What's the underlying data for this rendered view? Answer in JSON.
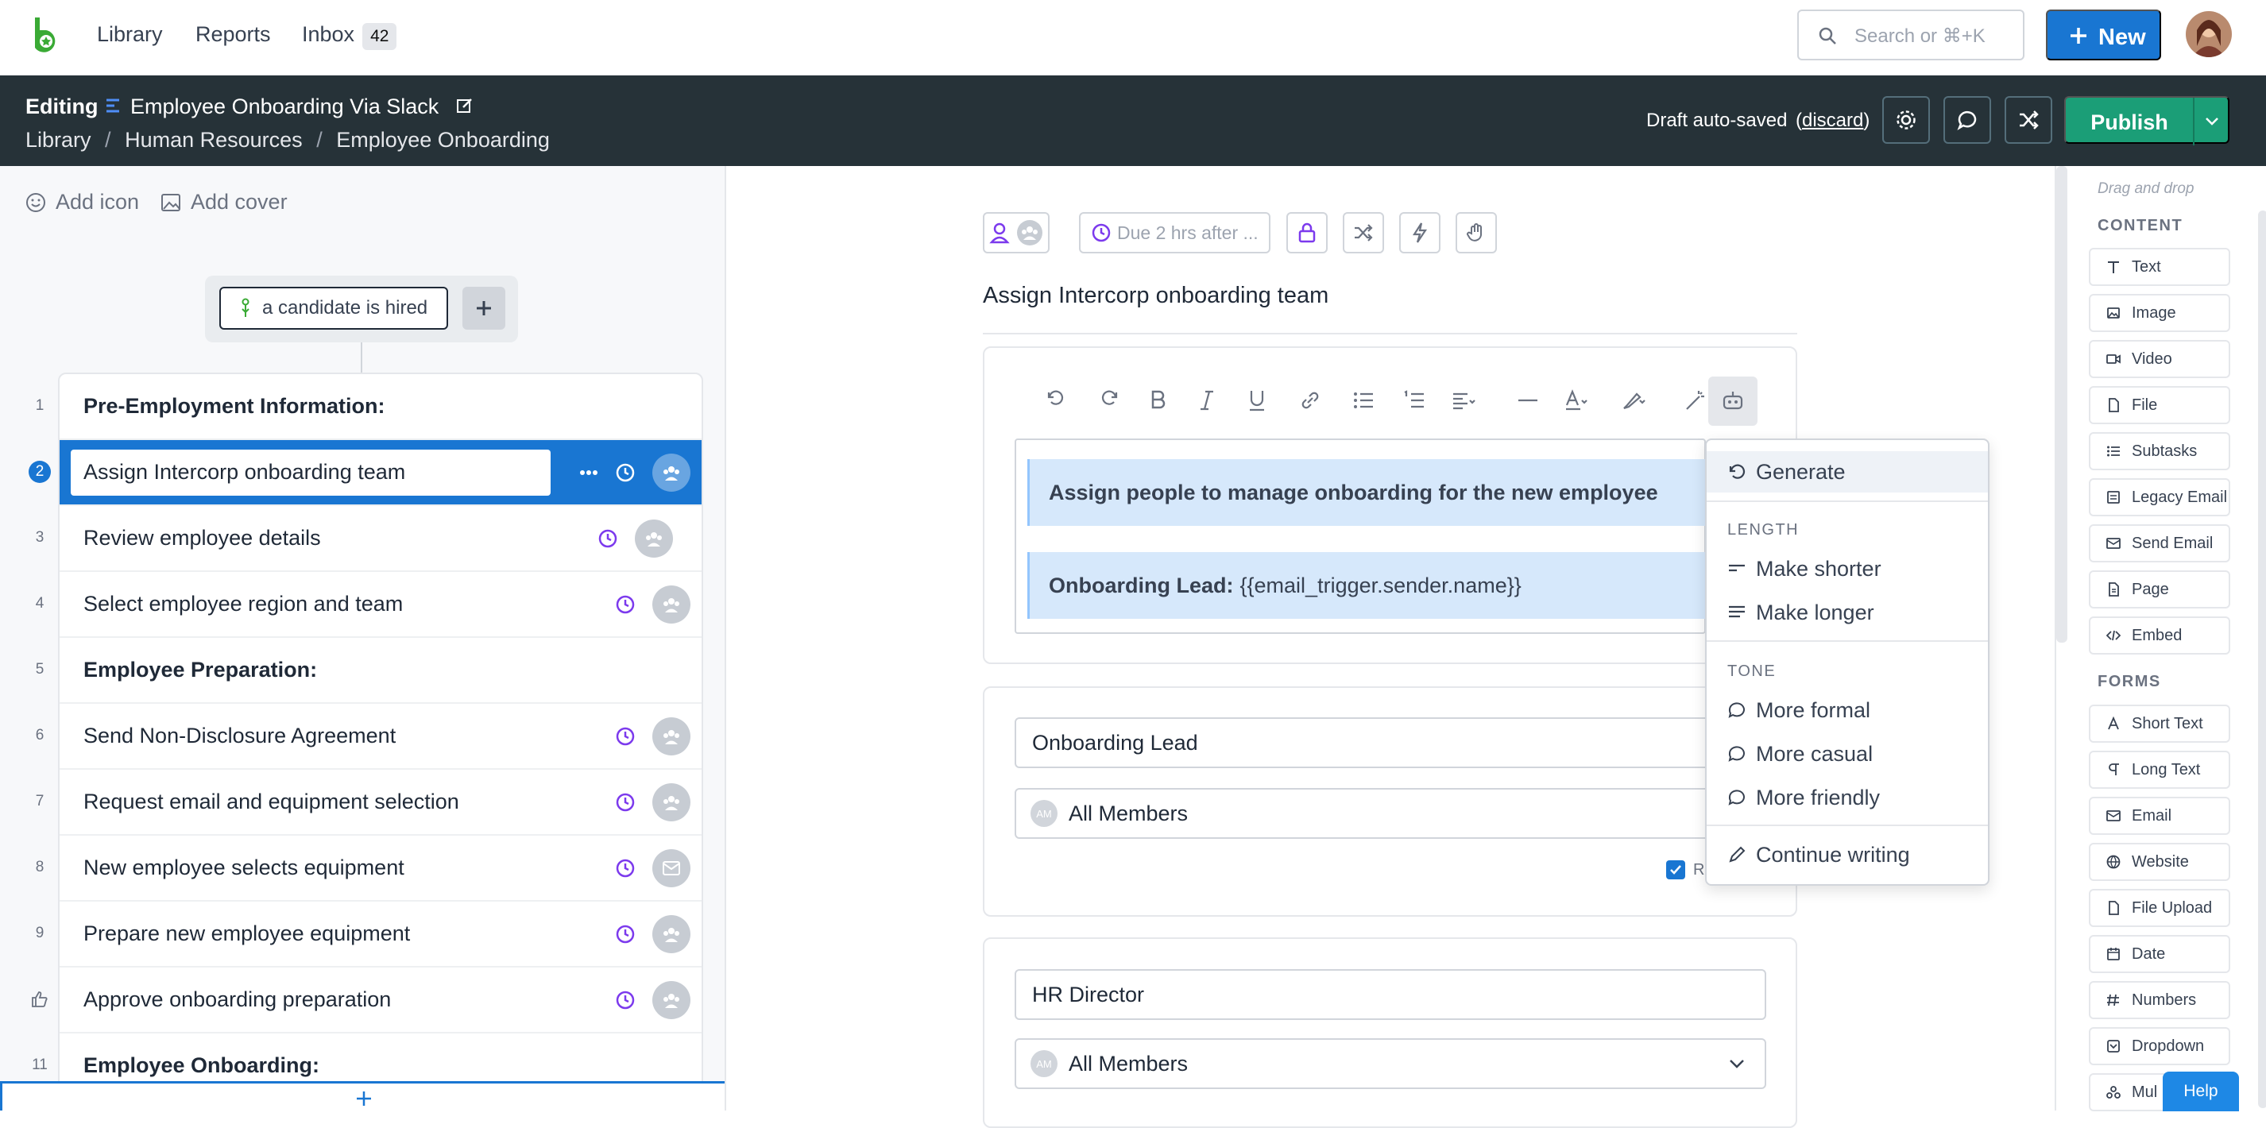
{
  "nav": {
    "links": [
      "Library",
      "Reports",
      "Inbox"
    ],
    "inbox_count": "42",
    "search_placeholder": "Search or ⌘+K",
    "new_label": "New"
  },
  "editbar": {
    "mode": "Editing",
    "workflow_title": "Employee Onboarding Via Slack",
    "breadcrumb": [
      "Library",
      "Human Resources",
      "Employee Onboarding"
    ],
    "autosave_text": "Draft auto-saved",
    "discard_label": "discard",
    "publish_label": "Publish"
  },
  "left": {
    "add_icon": "Add icon",
    "add_cover": "Add cover",
    "trigger_label": "a candidate is hired",
    "steps": [
      {
        "num": "1",
        "label": "Pre-Employment Information:",
        "heading": true
      },
      {
        "num": "2",
        "label": "Assign Intercorp onboarding team",
        "selected": true
      },
      {
        "num": "3",
        "label": "Review employee details"
      },
      {
        "num": "4",
        "label": "Select employee region and team"
      },
      {
        "num": "5",
        "label": "Employee Preparation:",
        "heading": true
      },
      {
        "num": "6",
        "label": "Send Non-Disclosure Agreement"
      },
      {
        "num": "7",
        "label": "Request email and equipment selection"
      },
      {
        "num": "8",
        "label": "New employee selects equipment"
      },
      {
        "num": "9",
        "label": "Prepare new employee equipment"
      },
      {
        "num": "",
        "label": "Approve onboarding preparation"
      },
      {
        "num": "11",
        "label": "Employee Onboarding:",
        "heading": true
      }
    ]
  },
  "center": {
    "due_label": "Due 2 hrs after ...",
    "task_title": "Assign Intercorp onboarding team",
    "text_block_1": "Assign people to manage onboarding for the new employee",
    "text_block_2_bold": "Onboarding Lead:",
    "text_block_2_var": "{{email_trigger.sender.name}}",
    "field1_label": "Onboarding Lead",
    "field1_members": "All Members",
    "required_partial": "Re",
    "field2_label": "HR Director",
    "field2_members": "All Members",
    "am_initials": "AM"
  },
  "ai_menu": {
    "generate": "Generate",
    "length_header": "LENGTH",
    "make_shorter": "Make shorter",
    "make_longer": "Make longer",
    "tone_header": "TONE",
    "more_formal": "More formal",
    "more_casual": "More casual",
    "more_friendly": "More friendly",
    "continue_writing": "Continue writing"
  },
  "right": {
    "hint": "Drag and drop",
    "content_header": "CONTENT",
    "content_items": [
      "Text",
      "Image",
      "Video",
      "File",
      "Subtasks",
      "Legacy Email",
      "Send Email",
      "Page",
      "Embed"
    ],
    "forms_header": "FORMS",
    "form_items": [
      "Short Text",
      "Long Text",
      "Email",
      "Website",
      "File Upload",
      "Date",
      "Numbers",
      "Dropdown",
      "Mul"
    ],
    "help_label": "Help"
  },
  "colors": {
    "primary": "#1976d2",
    "dark_bar": "#263238",
    "publish": "#1b9e77",
    "block_bg": "#d6e8fb"
  }
}
